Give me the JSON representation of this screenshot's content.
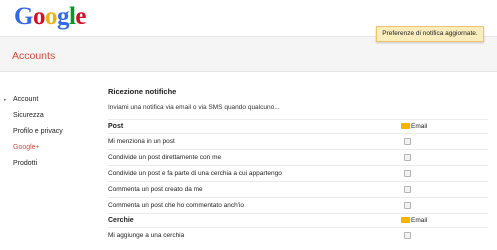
{
  "logo": {
    "letters": [
      "G",
      "o",
      "o",
      "g",
      "l",
      "e"
    ],
    "colors": [
      "#3369e8",
      "#d50f25",
      "#eeb211",
      "#3369e8",
      "#009925",
      "#d50f25"
    ]
  },
  "toast": {
    "message": "Preferenze di notifica aggiornate."
  },
  "header": {
    "title": "Accounts"
  },
  "sidebar": {
    "items": [
      {
        "label": "Account",
        "active": false,
        "arrow": "▸"
      },
      {
        "label": "Sicurezza",
        "active": false
      },
      {
        "label": "Profilo e privacy",
        "active": false
      },
      {
        "label": "Google+",
        "active": true
      },
      {
        "label": "Prodotti",
        "active": false
      }
    ]
  },
  "main": {
    "title": "Ricezione notifiche",
    "subtitle": "Inviami una notifica via email o via SMS quando qualcuno...",
    "groups": [
      {
        "name": "Post",
        "column_label": "Email",
        "rows": [
          {
            "label": "Mi menziona in un post",
            "checked": false
          },
          {
            "label": "Condivide un post direttamente con me",
            "checked": false
          },
          {
            "label": "Condivide un post e fa parte di una cerchia a cui appartengo",
            "checked": false
          },
          {
            "label": "Commenta un post creato da me",
            "checked": false
          },
          {
            "label": "Commenta un post che ho commentato anch'io",
            "checked": false
          }
        ]
      },
      {
        "name": "Cerchie",
        "column_label": "Email",
        "rows": [
          {
            "label": "Mi aggiunge a una cerchia",
            "checked": false
          }
        ]
      }
    ]
  },
  "icons": {
    "envelope": "envelope-icon",
    "checkbox": "checkbox"
  }
}
